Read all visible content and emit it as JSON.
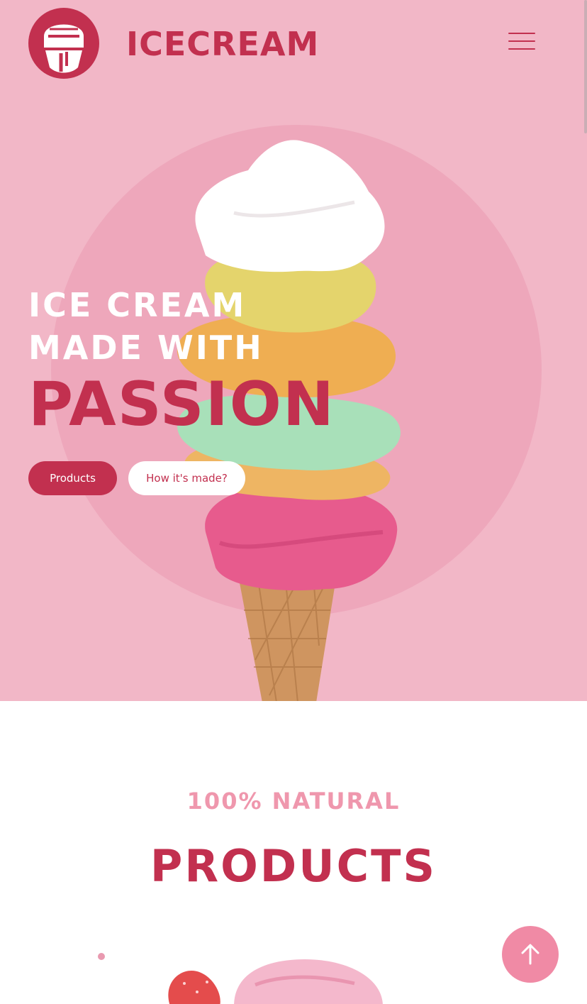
{
  "header": {
    "brand": "ICECREAM",
    "logo_icon": "ice-cream-logo-icon",
    "menu_icon": "hamburger-menu-icon"
  },
  "hero": {
    "line1": "ICE CREAM",
    "line2": "MADE WITH",
    "line3": "PASSION",
    "buttons": {
      "products": "Products",
      "how_made": "How it's made?"
    }
  },
  "products_section": {
    "kicker": "100% NATURAL",
    "title": "PRODUCTS"
  },
  "scroll_top": {
    "icon": "arrow-up-icon"
  },
  "colors": {
    "hero_bg": "#f2b7c7",
    "circle": "#eea7bb",
    "brand": "#c2304f",
    "kicker": "#ef97ad",
    "scroll_top_bg": "#f08aa5"
  }
}
